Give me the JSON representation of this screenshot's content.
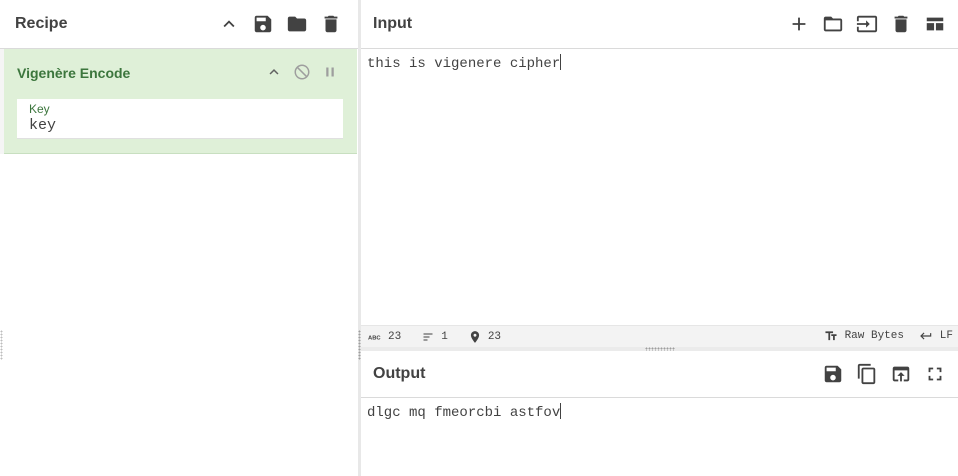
{
  "recipe": {
    "title": "Recipe",
    "buttons": [
      "collapse-all-icon",
      "save-icon",
      "folder-icon",
      "trash-icon"
    ],
    "operation": {
      "name": "Vigenère Encode",
      "arg_label": "Key",
      "arg_value": "key",
      "accent_color": "#3c763d",
      "background_color": "#dff0d8"
    }
  },
  "input": {
    "title": "Input",
    "buttons": [
      "plus-icon",
      "open-folder-icon",
      "open-file-icon",
      "trash-icon",
      "layout-icon"
    ],
    "text": "this is vigenere cipher",
    "status": {
      "length": "23",
      "lines": "1",
      "position": "23",
      "encoding": "Raw Bytes",
      "eol": "LF"
    }
  },
  "output": {
    "title": "Output",
    "buttons": [
      "save-icon",
      "copy-icon",
      "replace-input-icon",
      "fullscreen-icon"
    ],
    "text": "dlgc mq fmeorcbi astfov"
  }
}
